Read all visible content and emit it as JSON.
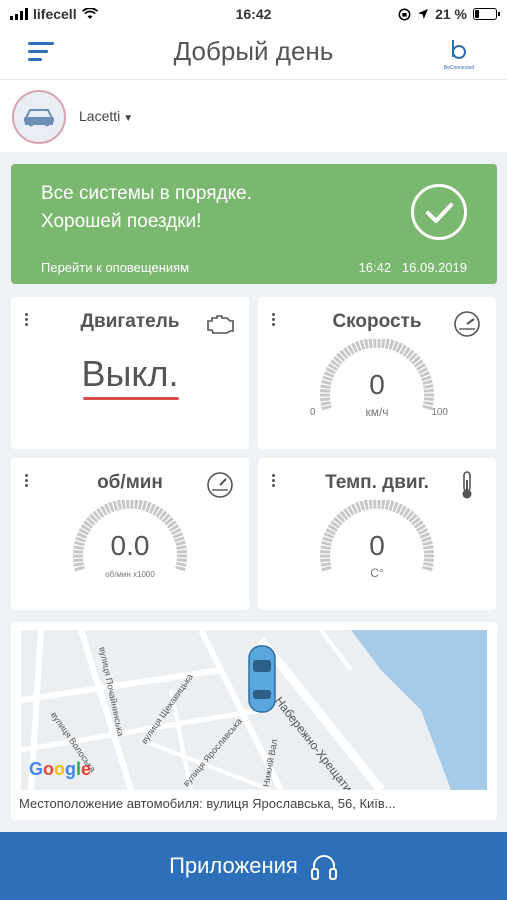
{
  "status_bar": {
    "carrier": "lifecell",
    "time": "16:42",
    "battery": "21 %",
    "battery_level": 0.21
  },
  "header": {
    "title": "Добрый день",
    "brand_name": "BeConnected",
    "brand_letter": "b"
  },
  "car": {
    "name": "Lacetti"
  },
  "status_card": {
    "line1": "Все системы в порядке.",
    "line2": "Хорошей поездки!",
    "link": "Перейти к оповещениям",
    "timestamp": "16:42   16.09.2019"
  },
  "tiles": {
    "engine": {
      "title": "Двигатель",
      "value": "Выкл."
    },
    "speed": {
      "title": "Скорость",
      "value": "0",
      "unit": "км/ч",
      "min": "0",
      "max": "100"
    },
    "rpm": {
      "title": "об/мин",
      "value": "0.0",
      "unit": "об/мин x1000"
    },
    "temp": {
      "title": "Темп. двиг.",
      "value": "0",
      "unit": "C°"
    }
  },
  "map": {
    "streets": [
      "вулиця Почайнинська",
      "вулиця Щекавицька",
      "вулиця Волоська",
      "вулиця Ярославська",
      "Набережно-Хрещатицька",
      "Нижній Вал"
    ],
    "google": "Google",
    "address": "Местоположение автомобиля: вулиця Ярославська, 56, Київ..."
  },
  "bottom": {
    "label": "Приложения"
  },
  "colors": {
    "accent": "#2d6fb8",
    "ok": "#7bb86f",
    "warn_line": "#d84c4c"
  }
}
